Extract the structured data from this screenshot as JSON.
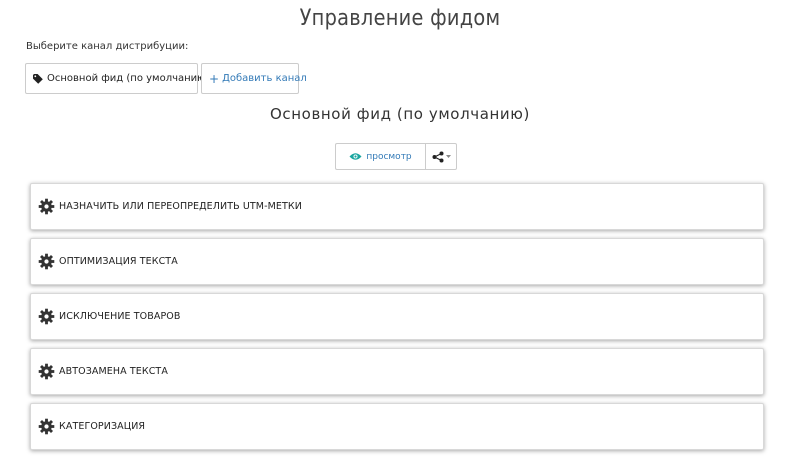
{
  "header": {
    "title": "Управление фидом"
  },
  "channels": {
    "label": "Выберите канал дистрибуции:",
    "active_channel": {
      "label": "Основной фид (по умолчанию)",
      "icon": "tag-icon"
    },
    "add_button": {
      "label": "Добавить канал",
      "icon": "plus-icon"
    }
  },
  "feed": {
    "title": "Основной фид (по умолчанию)",
    "preview_button": {
      "label": "просмотр",
      "icon": "eye-icon",
      "color": "#1aa6a0"
    },
    "share_button": {
      "icon": "share-icon"
    }
  },
  "panels": [
    {
      "label": "НАЗНАЧИТЬ ИЛИ ПЕРЕОПРЕДЕЛИТЬ UTM-МЕТКИ",
      "icon": "gear-icon"
    },
    {
      "label": "ОПТИМИЗАЦИЯ ТЕКСТА",
      "icon": "gear-icon"
    },
    {
      "label": "ИСКЛЮЧЕНИЕ ТОВАРОВ",
      "icon": "gear-icon"
    },
    {
      "label": "АВТОЗАМЕНА ТЕКСТА",
      "icon": "gear-icon"
    },
    {
      "label": "КАТЕГОРИЗАЦИЯ",
      "icon": "gear-icon"
    }
  ],
  "colors": {
    "link": "#337ab7",
    "preview_icon": "#1aa6a0",
    "border": "#cccccc"
  }
}
